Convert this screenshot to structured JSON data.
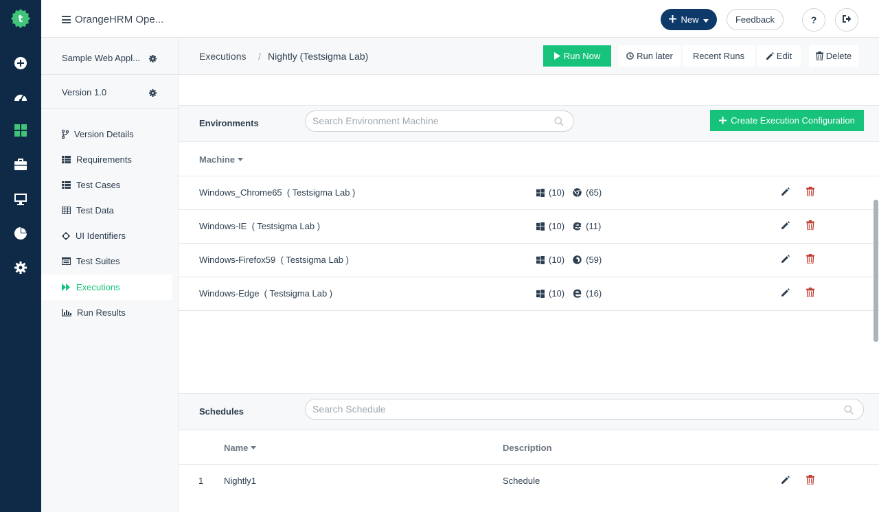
{
  "app": {
    "title": "OrangeHRM Ope..."
  },
  "topbar": {
    "new_label": "New",
    "feedback_label": "Feedback",
    "help_label": "?"
  },
  "project": {
    "name": "Sample Web Appl...",
    "version": "Version 1.0"
  },
  "nav": [
    {
      "label": "Version Details"
    },
    {
      "label": "Requirements"
    },
    {
      "label": "Test Cases"
    },
    {
      "label": "Test Data"
    },
    {
      "label": "UI Identifiers"
    },
    {
      "label": "Test Suites"
    },
    {
      "label": "Executions"
    },
    {
      "label": "Run Results"
    }
  ],
  "breadcrumb": {
    "parent": "Executions",
    "separator": "/",
    "current": "Nightly (Testsigma Lab)"
  },
  "actions": {
    "run_now": "Run Now",
    "run_later": "Run later",
    "recent_runs": "Recent Runs",
    "edit": "Edit",
    "delete": "Delete"
  },
  "environments": {
    "title": "Environments",
    "search_placeholder": "Search Environment Machine",
    "create_label": "Create Execution Configuration",
    "column_machine": "Machine",
    "rows": [
      {
        "name": "Windows_Chrome65",
        "lab": "( Testsigma Lab )",
        "os_version": "(10)",
        "browser": "chrome",
        "browser_version": "(65)"
      },
      {
        "name": "Windows-IE",
        "lab": "( Testsigma Lab )",
        "os_version": "(10)",
        "browser": "ie",
        "browser_version": "(11)"
      },
      {
        "name": "Windows-Firefox59",
        "lab": "( Testsigma Lab )",
        "os_version": "(10)",
        "browser": "firefox",
        "browser_version": "(59)"
      },
      {
        "name": "Windows-Edge",
        "lab": "( Testsigma Lab )",
        "os_version": "(10)",
        "browser": "edge",
        "browser_version": "(16)"
      }
    ]
  },
  "schedules": {
    "title": "Schedules",
    "search_placeholder": "Search Schedule",
    "column_name": "Name",
    "column_description": "Description",
    "rows": [
      {
        "index": "1",
        "name": "Nightly1",
        "description": "Schedule"
      }
    ]
  },
  "colors": {
    "rail": "#0e2a47",
    "accent": "#17c37b",
    "primary": "#0e3a6b",
    "danger": "#c0392b"
  }
}
